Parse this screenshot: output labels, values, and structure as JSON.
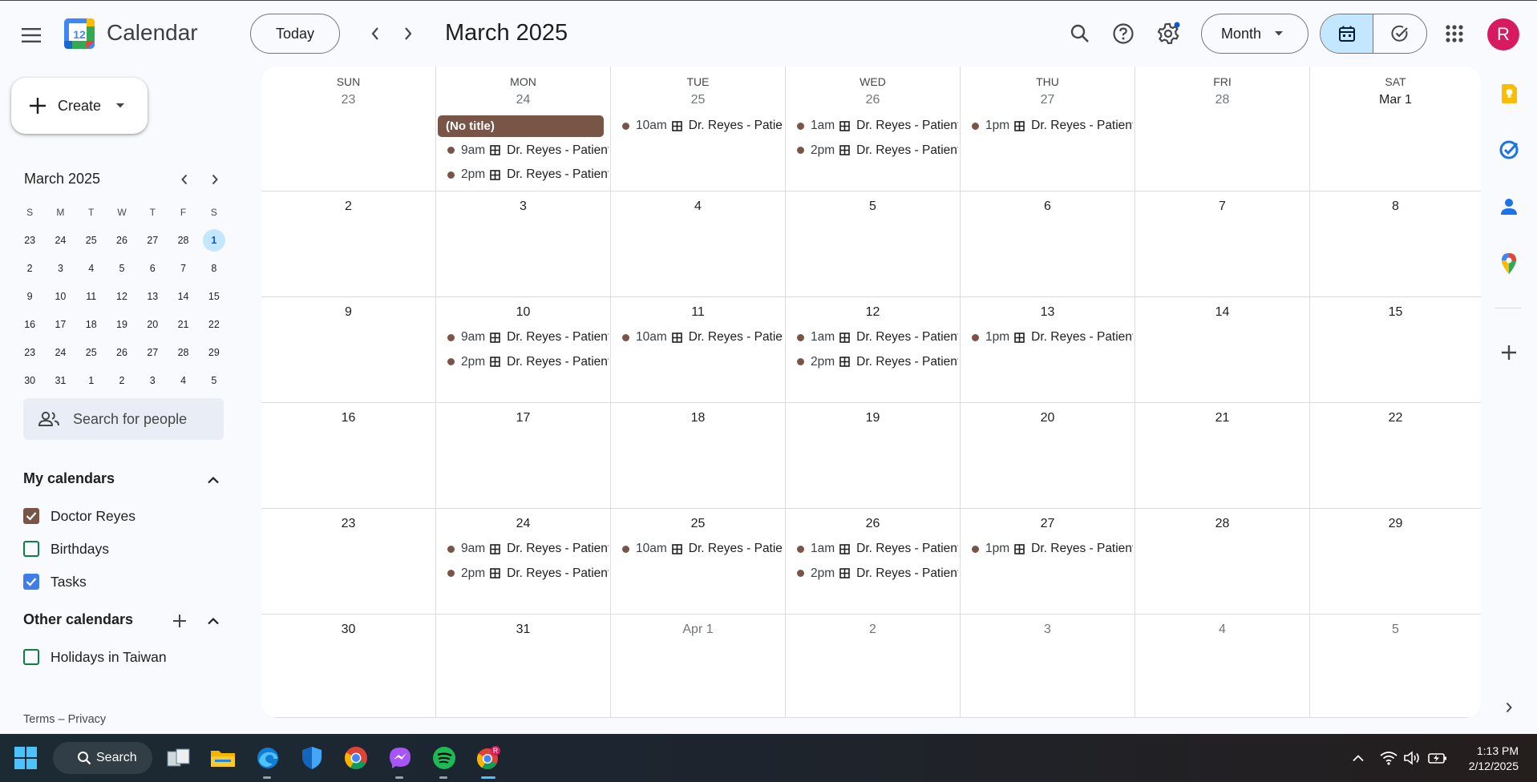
{
  "header": {
    "app_title": "Calendar",
    "logo_day": "12",
    "today_label": "Today",
    "period": "March 2025",
    "view_label": "Month",
    "avatar_initial": "R"
  },
  "sidebar": {
    "create_label": "Create",
    "mini_month": "March 2025",
    "mini_headers": [
      "S",
      "M",
      "T",
      "W",
      "T",
      "F",
      "S"
    ],
    "mini_weeks": [
      [
        "23",
        "24",
        "25",
        "26",
        "27",
        "28",
        "1"
      ],
      [
        "2",
        "3",
        "4",
        "5",
        "6",
        "7",
        "8"
      ],
      [
        "9",
        "10",
        "11",
        "12",
        "13",
        "14",
        "15"
      ],
      [
        "16",
        "17",
        "18",
        "19",
        "20",
        "21",
        "22"
      ],
      [
        "23",
        "24",
        "25",
        "26",
        "27",
        "28",
        "29"
      ],
      [
        "30",
        "31",
        "1",
        "2",
        "3",
        "4",
        "5"
      ]
    ],
    "people_search_placeholder": "Search for people",
    "my_calendars_title": "My calendars",
    "my_calendars": [
      {
        "label": "Doctor Reyes",
        "checked": true,
        "color": "#795548"
      },
      {
        "label": "Birthdays",
        "checked": false,
        "color": "#0b8043"
      },
      {
        "label": "Tasks",
        "checked": true,
        "color": "#3f7ee8"
      }
    ],
    "other_calendars_title": "Other calendars",
    "other_calendars": [
      {
        "label": "Holidays in Taiwan",
        "checked": false,
        "color": "#0b8043"
      }
    ],
    "footer": "Terms – Privacy"
  },
  "month": {
    "weekdays": [
      "SUN",
      "MON",
      "TUE",
      "WED",
      "THU",
      "FRI",
      "SAT"
    ],
    "weeks": [
      [
        "23",
        "24",
        "25",
        "26",
        "27",
        "28",
        "Mar 1"
      ],
      [
        "2",
        "3",
        "4",
        "5",
        "6",
        "7",
        "8"
      ],
      [
        "9",
        "10",
        "11",
        "12",
        "13",
        "14",
        "15"
      ],
      [
        "16",
        "17",
        "18",
        "19",
        "20",
        "21",
        "22"
      ],
      [
        "23",
        "24",
        "25",
        "26",
        "27",
        "28",
        "29"
      ],
      [
        "30",
        "31",
        "Apr 1",
        "2",
        "3",
        "4",
        "5"
      ]
    ],
    "muted": [
      [
        0,
        0
      ],
      [
        0,
        1
      ],
      [
        0,
        2
      ],
      [
        0,
        3
      ],
      [
        0,
        4
      ],
      [
        0,
        5
      ],
      [
        5,
        2
      ],
      [
        5,
        3
      ],
      [
        5,
        4
      ],
      [
        5,
        5
      ],
      [
        5,
        6
      ]
    ],
    "event_color": "#795548",
    "events": [
      {
        "week": 0,
        "day": 1,
        "block": true,
        "title": "(No title)"
      },
      {
        "week": 0,
        "day": 1,
        "time": "9am",
        "title": "Dr. Reyes - Patient"
      },
      {
        "week": 0,
        "day": 1,
        "time": "2pm",
        "title": "Dr. Reyes - Patient"
      },
      {
        "week": 0,
        "day": 2,
        "time": "10am",
        "title": "Dr. Reyes - Patient"
      },
      {
        "week": 0,
        "day": 3,
        "time": "1am",
        "title": "Dr. Reyes - Patient"
      },
      {
        "week": 0,
        "day": 3,
        "time": "2pm",
        "title": "Dr. Reyes - Patient"
      },
      {
        "week": 0,
        "day": 4,
        "time": "1pm",
        "title": "Dr. Reyes - Patient"
      },
      {
        "week": 2,
        "day": 1,
        "time": "9am",
        "title": "Dr. Reyes - Patient"
      },
      {
        "week": 2,
        "day": 1,
        "time": "2pm",
        "title": "Dr. Reyes - Patient"
      },
      {
        "week": 2,
        "day": 2,
        "time": "10am",
        "title": "Dr. Reyes - Patient"
      },
      {
        "week": 2,
        "day": 3,
        "time": "1am",
        "title": "Dr. Reyes - Patient"
      },
      {
        "week": 2,
        "day": 3,
        "time": "2pm",
        "title": "Dr. Reyes - Patient"
      },
      {
        "week": 2,
        "day": 4,
        "time": "1pm",
        "title": "Dr. Reyes - Patient"
      },
      {
        "week": 4,
        "day": 1,
        "time": "9am",
        "title": "Dr. Reyes - Patient"
      },
      {
        "week": 4,
        "day": 1,
        "time": "2pm",
        "title": "Dr. Reyes - Patient"
      },
      {
        "week": 4,
        "day": 2,
        "time": "10am",
        "title": "Dr. Reyes - Patient"
      },
      {
        "week": 4,
        "day": 3,
        "time": "1am",
        "title": "Dr. Reyes - Patient"
      },
      {
        "week": 4,
        "day": 3,
        "time": "2pm",
        "title": "Dr. Reyes - Patient"
      },
      {
        "week": 4,
        "day": 4,
        "time": "1pm",
        "title": "Dr. Reyes - Patient"
      }
    ]
  },
  "taskbar": {
    "search_label": "Search",
    "time": "1:13 PM",
    "date": "2/12/2025",
    "chrome_badge": "R"
  }
}
